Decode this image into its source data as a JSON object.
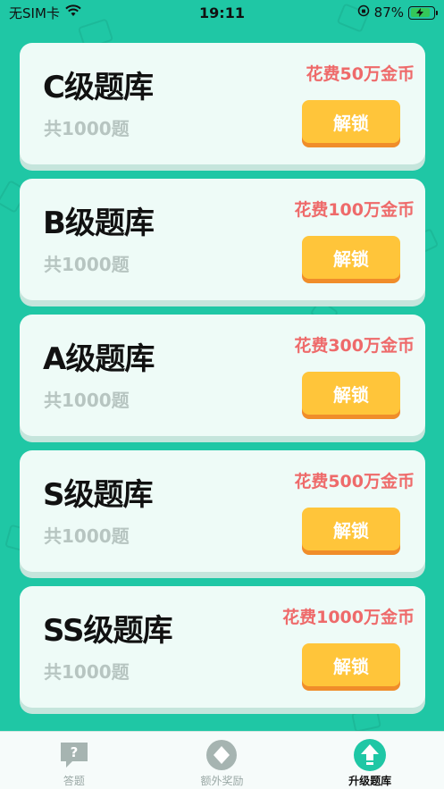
{
  "status_bar": {
    "carrier": "无SIM卡",
    "time": "19:11",
    "battery_percent": "87%",
    "battery_level": 0.87
  },
  "cards": [
    {
      "title": "C级题库",
      "count": "共1000题",
      "cost": "花费50万金币",
      "button": "解锁"
    },
    {
      "title": "B级题库",
      "count": "共1000题",
      "cost": "花费100万金币",
      "button": "解锁"
    },
    {
      "title": "A级题库",
      "count": "共1000题",
      "cost": "花费300万金币",
      "button": "解锁"
    },
    {
      "title": "S级题库",
      "count": "共1000题",
      "cost": "花费500万金币",
      "button": "解锁"
    },
    {
      "title": "SS级题库",
      "count": "共1000题",
      "cost": "花费1000万金币",
      "button": "解锁"
    }
  ],
  "tab_bar": {
    "tabs": [
      {
        "label": "答题",
        "icon": "question-icon",
        "active": false
      },
      {
        "label": "额外奖励",
        "icon": "diamond-icon",
        "active": false
      },
      {
        "label": "升级题库",
        "icon": "upgrade-arrow-icon",
        "active": true
      }
    ]
  },
  "colors": {
    "background": "#1fc7a5",
    "card": "#eefbf7",
    "cost_text": "#ee6a6a",
    "button": "#ffc53a",
    "button_shadow": "#f08d2a"
  }
}
